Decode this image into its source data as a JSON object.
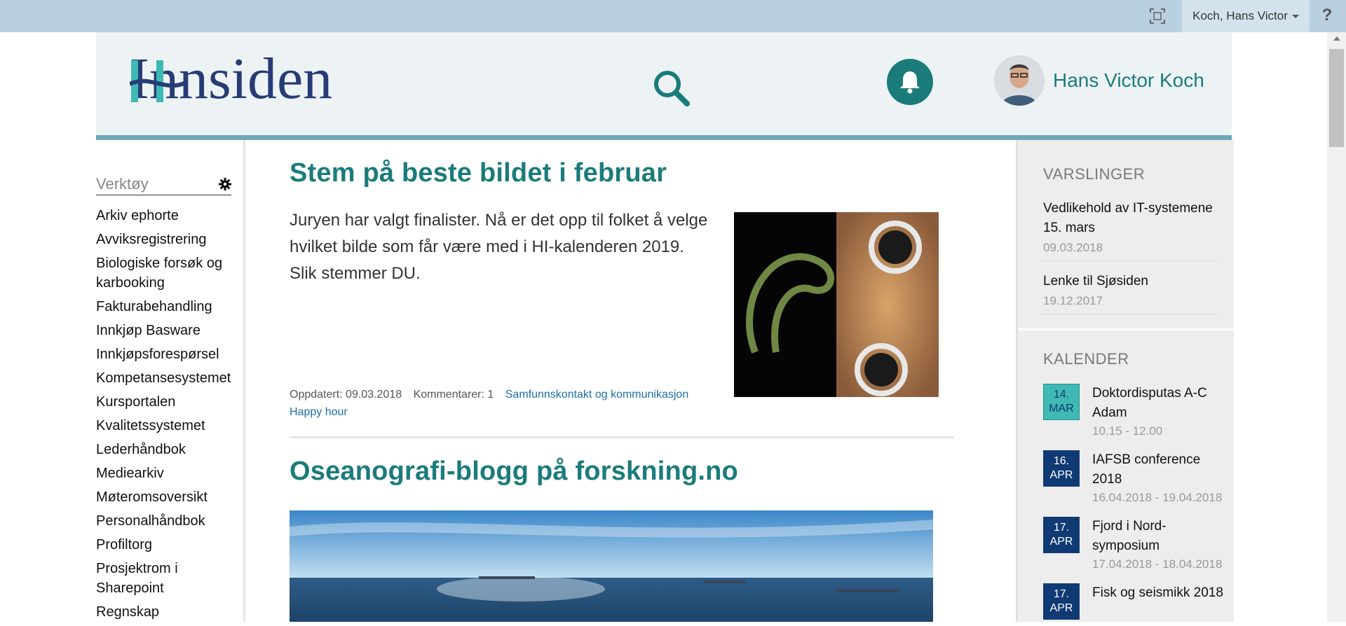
{
  "suitebar": {
    "user_menu_label": "Koch, Hans Victor",
    "help_label": "?",
    "focus_icon": "focus-mode-icon"
  },
  "header": {
    "logo_text": "Innsiden",
    "search_icon": "search-icon",
    "notification_icon": "bell-icon",
    "profile_name": "Hans Victor Koch"
  },
  "leftnav": {
    "heading": "Verktøy",
    "items": [
      "Arkiv ephorte",
      "Avviksregistrering",
      "Biologiske forsøk og karbooking",
      "Fakturabehandling",
      "Innkjøp Basware",
      "Innkjøpsforespørsel",
      "Kompetansesystemet",
      "Kursportalen",
      "Kvalitetssystemet",
      "Lederhåndbok",
      "Mediearkiv",
      "Møteromsoversikt",
      "Personalhåndbok",
      "Profiltorg",
      "Prosjektrom i Sharepoint",
      "Regnskap"
    ]
  },
  "articles": [
    {
      "title": "Stem på beste bildet i februar",
      "body": "Juryen har valgt finalister. Nå er det opp til folket å velge hvilket bilde som får være med i HI-kalenderen 2019. Slik stemmer DU.",
      "updated_label": "Oppdatert: 09.03.2018",
      "comments_label": "Kommentarer: 1",
      "tags": [
        "Samfunnskontakt og kommunikasjon",
        "Happy hour"
      ]
    },
    {
      "title": "Oseanografi-blogg på forskning.no"
    }
  ],
  "notifications": {
    "heading": "VARSLINGER",
    "items": [
      {
        "title": "Vedlikehold av IT-systemene 15. mars",
        "date": "09.03.2018"
      },
      {
        "title": "Lenke til Sjøsiden",
        "date": "19.12.2017"
      }
    ]
  },
  "calendar": {
    "heading": "KALENDER",
    "events": [
      {
        "day": "14.",
        "month": "MAR",
        "title": "Doktordisputas A-C Adam",
        "time": "10.15 - 12.00",
        "style": "today"
      },
      {
        "day": "16.",
        "month": "APR",
        "title": "IAFSB conference 2018",
        "time": "16.04.2018 - 19.04.2018",
        "style": "future"
      },
      {
        "day": "17.",
        "month": "APR",
        "title": "Fjord i Nord-symposium",
        "time": "17.04.2018 - 18.04.2018",
        "style": "future"
      },
      {
        "day": "17.",
        "month": "APR",
        "title": "Fisk og seismikk 2018",
        "time": "",
        "style": "future"
      }
    ]
  },
  "colors": {
    "brand_teal": "#1b7b7b",
    "suitebar": "#b9d0e0",
    "header_bg": "#edf3f5",
    "calendar_today": "#3fb9b3",
    "calendar_future": "#0f3a73",
    "link": "#1d6fa5"
  }
}
